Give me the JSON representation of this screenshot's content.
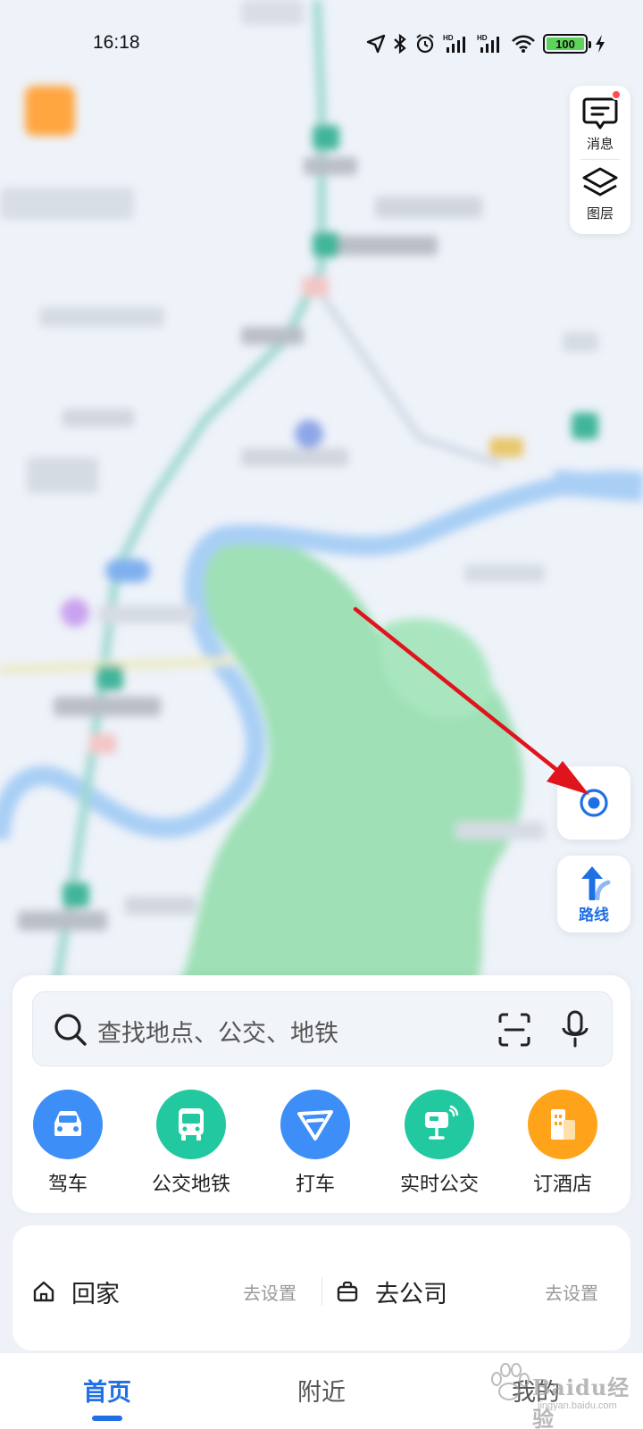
{
  "status_bar": {
    "time": "16:18",
    "battery": "100",
    "icons": [
      "location-icon",
      "bluetooth-icon",
      "alarm-icon",
      "hd-signal-icon",
      "hd-signal-icon",
      "wifi-icon",
      "battery-icon",
      "charging-icon"
    ]
  },
  "side_panel": {
    "messages_label": "消息",
    "layers_label": "图层"
  },
  "map_controls": {
    "route_label": "路线"
  },
  "search": {
    "placeholder": "查找地点、公交、地铁"
  },
  "quick_actions": [
    {
      "label": "驾车",
      "icon": "car-icon",
      "color": "#3d8ef7"
    },
    {
      "label": "公交地铁",
      "icon": "bus-icon",
      "color": "#22c8a0"
    },
    {
      "label": "打车",
      "icon": "taxi-icon",
      "color": "#3d8ef7"
    },
    {
      "label": "实时公交",
      "icon": "bus-stop-icon",
      "color": "#22c8a0"
    },
    {
      "label": "订酒店",
      "icon": "hotel-icon",
      "color": "#ffa31a"
    }
  ],
  "shortcuts": {
    "home_label": "回家",
    "home_action": "去设置",
    "company_label": "去公司",
    "company_action": "去设置"
  },
  "bottom_nav": {
    "tabs": [
      "首页",
      "附近",
      "我的"
    ],
    "active": 0
  },
  "watermark": {
    "text": "Baidu经验",
    "sub": "jingyan.baidu.com"
  },
  "colors": {
    "accent": "#1f6fe5",
    "annotation_arrow": "#e0141c"
  }
}
